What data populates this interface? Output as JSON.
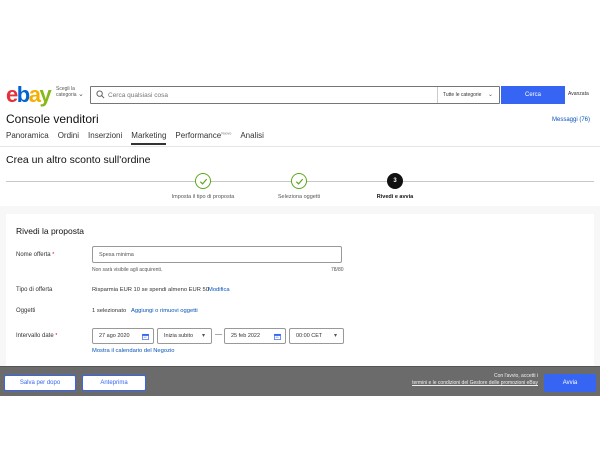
{
  "header": {
    "logo_letters": [
      "e",
      "b",
      "a",
      "y"
    ],
    "shop_by_category": "Scegli la categoria",
    "search_placeholder": "Cerca qualsiasi cosa",
    "category_select": "Tutte le categorie",
    "search_button": "Cerca",
    "advanced_link": "Avanzata"
  },
  "console": {
    "title": "Console venditori",
    "messages": "Messaggi (76)"
  },
  "nav": {
    "tabs": [
      {
        "label": "Panoramica",
        "active": false
      },
      {
        "label": "Ordini",
        "active": false
      },
      {
        "label": "Inserzioni",
        "active": false
      },
      {
        "label": "Marketing",
        "active": true
      },
      {
        "label": "Performance",
        "badge": "Nuovo",
        "active": false
      },
      {
        "label": "Analisi",
        "active": false
      }
    ]
  },
  "page": {
    "heading": "Crea un altro sconto sull'ordine"
  },
  "stepper": {
    "steps": [
      {
        "label": "Imposta il tipo di proposta",
        "state": "done"
      },
      {
        "label": "Seleziona oggetti",
        "state": "done"
      },
      {
        "label": "Rivedi e avvia",
        "state": "current",
        "number": "3"
      }
    ],
    "done_color": "#5ba71b"
  },
  "review": {
    "title": "Rivedi la proposta",
    "offer_name_label": "Nome offerta",
    "required_mark": "*",
    "offer_name_value": "Spesa minima",
    "offer_name_hint": "Non sarà visibile agli acquirenti.",
    "offer_name_counter": "78/80",
    "offer_type_label": "Tipo di offerta",
    "offer_type_value": "Risparmia EUR 10 se spendi almeno EUR 50",
    "offer_type_edit": "Modifica",
    "items_label": "Oggetti",
    "items_value": "1 selezionato",
    "items_link": "Aggiungi o rimuovi oggetti",
    "date_range_label": "Intervallo date",
    "start_date": "27 ago 2020",
    "start_time": "Inizia subito",
    "end_date": "25 feb 2022",
    "end_time": "00:00 CET",
    "calendar_link": "Mostra il calendario del Negozio"
  },
  "footer": {
    "save_button": "Salva per dopo",
    "preview_button": "Anteprima",
    "terms_line1": "Con l'avvio, accetti i",
    "terms_line2": "termini e le condizioni del Gestore delle promozioni eBay",
    "launch_button": "Avvia"
  },
  "colors": {
    "accent": "#3665f3",
    "link": "#0654ba",
    "footer_bg": "#6b6b6b"
  }
}
